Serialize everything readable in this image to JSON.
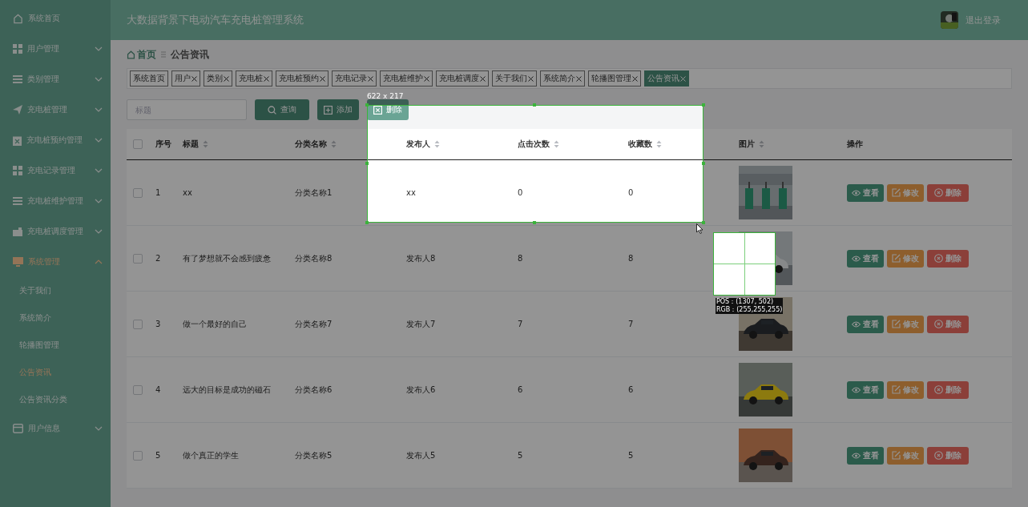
{
  "header": {
    "title": "大数据背景下电动汽车充电桩管理系统",
    "logout": "退出登录"
  },
  "sidebar": {
    "items": [
      {
        "kind": "link",
        "label": "系统首页",
        "selected": false
      },
      {
        "kind": "group",
        "label": "用户管理",
        "selected": false,
        "expanded": false
      },
      {
        "kind": "group",
        "label": "类别管理",
        "selected": false,
        "expanded": false
      },
      {
        "kind": "group",
        "label": "充电桩管理",
        "selected": false,
        "expanded": false
      },
      {
        "kind": "group",
        "label": "充电桩预约管理",
        "selected": false,
        "expanded": false
      },
      {
        "kind": "group",
        "label": "充电记录管理",
        "selected": false,
        "expanded": false
      },
      {
        "kind": "group",
        "label": "充电桩维护管理",
        "selected": false,
        "expanded": false
      },
      {
        "kind": "group",
        "label": "充电桩调度管理",
        "selected": false,
        "expanded": false
      },
      {
        "kind": "group",
        "label": "系统管理",
        "selected": true,
        "expanded": true,
        "children": [
          {
            "label": "关于我们",
            "selected": false
          },
          {
            "label": "系统简介",
            "selected": false
          },
          {
            "label": "轮播图管理",
            "selected": false
          },
          {
            "label": "公告资讯",
            "selected": true
          },
          {
            "label": "公告资讯分类",
            "selected": false
          }
        ]
      },
      {
        "kind": "group",
        "label": "用户信息",
        "selected": false,
        "expanded": false
      }
    ]
  },
  "breadcrumb": [
    "首页",
    "公告资讯"
  ],
  "tabs": [
    {
      "label": "系统首页",
      "closable": false,
      "selected": false
    },
    {
      "label": "用户",
      "closable": true,
      "selected": false
    },
    {
      "label": "类别",
      "closable": true,
      "selected": false
    },
    {
      "label": "充电桩",
      "closable": true,
      "selected": false
    },
    {
      "label": "充电桩预约",
      "closable": true,
      "selected": false
    },
    {
      "label": "充电记录",
      "closable": true,
      "selected": false
    },
    {
      "label": "充电桩维护",
      "closable": true,
      "selected": false
    },
    {
      "label": "充电桩调度",
      "closable": true,
      "selected": false
    },
    {
      "label": "关于我们",
      "closable": true,
      "selected": false
    },
    {
      "label": "系统简介",
      "closable": true,
      "selected": false
    },
    {
      "label": "轮播图管理",
      "closable": true,
      "selected": false
    },
    {
      "label": "公告资讯",
      "closable": true,
      "selected": true
    }
  ],
  "search": {
    "placeholder": "标题",
    "buttons": [
      {
        "kind": "search",
        "label": "查询"
      },
      {
        "kind": "add",
        "label": "添加"
      },
      {
        "kind": "delete",
        "label": "删除"
      }
    ]
  },
  "table": {
    "select_all": {
      "checked": false
    },
    "columns": [
      {
        "label": "序号",
        "sortable": false
      },
      {
        "label": "标题",
        "sortable": true
      },
      {
        "label": "分类名称",
        "sortable": true
      },
      {
        "label": "发布人",
        "sortable": true
      },
      {
        "label": "点击次数",
        "sortable": true
      },
      {
        "label": "收藏数",
        "sortable": true
      },
      {
        "label": "图片",
        "sortable": true
      },
      {
        "label": "操作",
        "sortable": false
      }
    ],
    "rows": [
      {
        "checked": false,
        "cells": [
          "1",
          "xx",
          "分类名称1",
          "xx",
          "0",
          "0"
        ],
        "actions": [
          {
            "kind": "view",
            "label": "查看"
          },
          {
            "kind": "edit",
            "label": "修改"
          },
          {
            "kind": "delete",
            "label": "删除"
          }
        ]
      },
      {
        "checked": false,
        "cells": [
          "2",
          "有了梦想就不会感到疲惫",
          "分类名称8",
          "发布人8",
          "8",
          "8"
        ],
        "actions": [
          {
            "kind": "view",
            "label": "查看"
          },
          {
            "kind": "edit",
            "label": "修改"
          },
          {
            "kind": "delete",
            "label": "删除"
          }
        ]
      },
      {
        "checked": false,
        "cells": [
          "3",
          "做一个最好的自己",
          "分类名称7",
          "发布人7",
          "7",
          "7"
        ],
        "actions": [
          {
            "kind": "view",
            "label": "查看"
          },
          {
            "kind": "edit",
            "label": "修改"
          },
          {
            "kind": "delete",
            "label": "删除"
          }
        ]
      },
      {
        "checked": false,
        "cells": [
          "4",
          "远大的目标是成功的磁石",
          "分类名称6",
          "发布人6",
          "6",
          "6"
        ],
        "actions": [
          {
            "kind": "view",
            "label": "查看"
          },
          {
            "kind": "edit",
            "label": "修改"
          },
          {
            "kind": "delete",
            "label": "删除"
          }
        ]
      },
      {
        "checked": false,
        "cells": [
          "5",
          "做个真正的学生",
          "分类名称5",
          "发布人5",
          "5",
          "5"
        ],
        "actions": [
          {
            "kind": "view",
            "label": "查看"
          },
          {
            "kind": "edit",
            "label": "修改"
          },
          {
            "kind": "delete",
            "label": "删除"
          }
        ]
      }
    ]
  },
  "screen_capture": {
    "size_label": "622 x 217",
    "position": "POS：(1307, 502)",
    "rgb_readout": "RGB：(255,255,255)"
  }
}
